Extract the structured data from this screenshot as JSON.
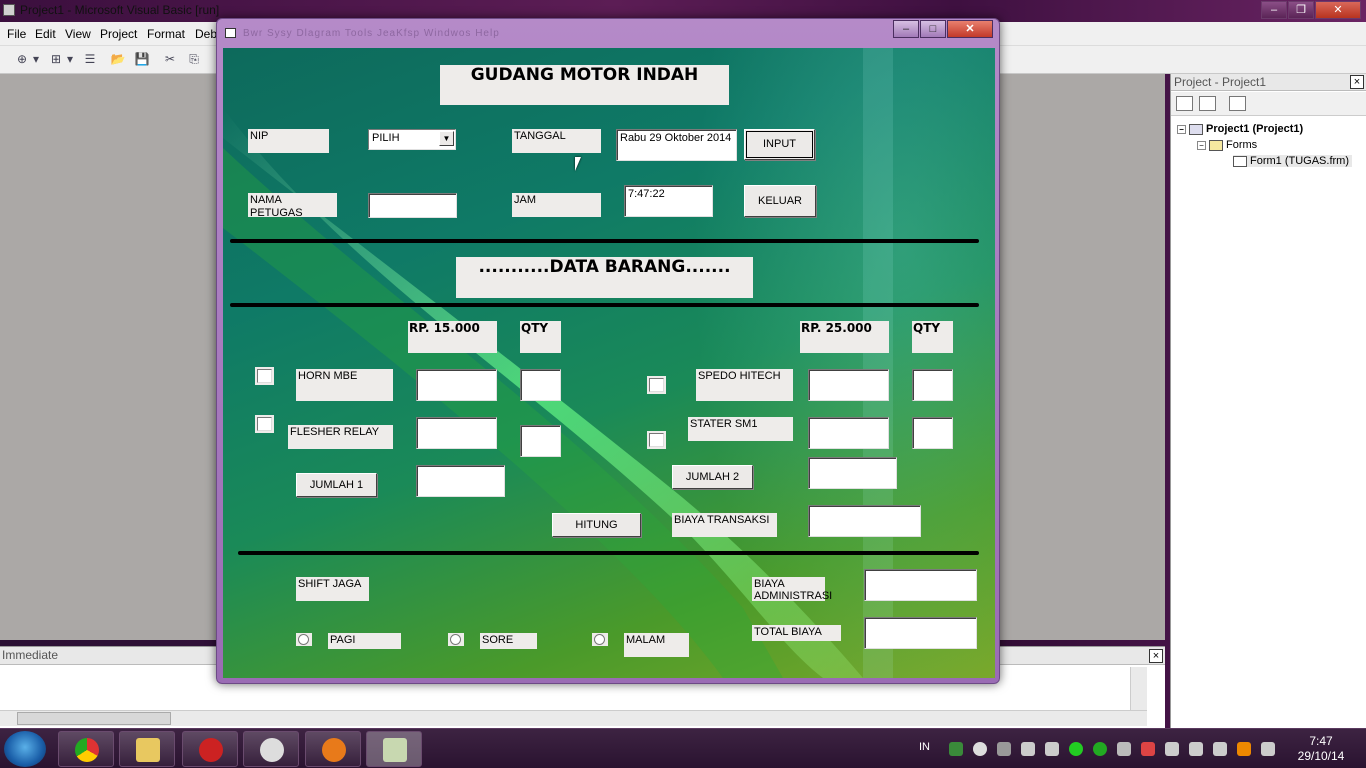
{
  "ide": {
    "title": "Project1 - Microsoft Visual Basic [run]",
    "menu": [
      "File",
      "Edit",
      "View",
      "Project",
      "Format",
      "Deb"
    ]
  },
  "project_panel": {
    "title": "Project - Project1",
    "close": "×",
    "tree": {
      "project": "Project1 (Project1)",
      "folder": "Forms",
      "form": "Form1 (TUGAS.frm)"
    }
  },
  "immediate": {
    "title": "Immediate",
    "close": "×"
  },
  "form": {
    "menu_blur": "Bwr  Sysy  Dlagram  Tools  JeaKfsp  Windwos  Help",
    "header": "GUDANG MOTOR INDAH",
    "nip_label": "NIP",
    "pilih_value": "PILIH",
    "tanggal_label": "TANGGAL",
    "tanggal_value": "Rabu 29 Oktober 2014",
    "input_button": "INPUT",
    "nama_label": "NAMA PETUGAS",
    "nama_value": "",
    "jam_label": "JAM",
    "jam_value": "7:47:22",
    "keluar_button": "KELUAR",
    "data_barang": "...........DATA BARANG.......",
    "price1": "RP. 15.000",
    "qty1": "QTY",
    "price2": "RP. 25.000",
    "qty2": "QTY",
    "item_horn": "HORN MBE",
    "item_flesher": "FLESHER RELAY",
    "item_spedo": "SPEDO HITECH",
    "item_stater": "STATER SM1",
    "jumlah1_button": "JUMLAH 1",
    "jumlah2_button": "JUMLAH 2",
    "hitung_button": "HITUNG",
    "biaya_transaksi": "BIAYA TRANSAKSI",
    "shift_jaga": "SHIFT JAGA",
    "biaya_admin": "BIAYA ADMINISTRASI",
    "total_biaya": "TOTAL BIAYA",
    "opt_pagi": "PAGI",
    "opt_sore": "SORE",
    "opt_malam": "MALAM"
  },
  "taskbar": {
    "lang": "IN",
    "time": "7:47",
    "date": "29/10/14"
  },
  "colors": {
    "form_bg_start": "#0d6a5c",
    "form_bg_end": "#7aa82a",
    "label_bg": "#eeecea",
    "window_frame": "#b58ac8"
  }
}
